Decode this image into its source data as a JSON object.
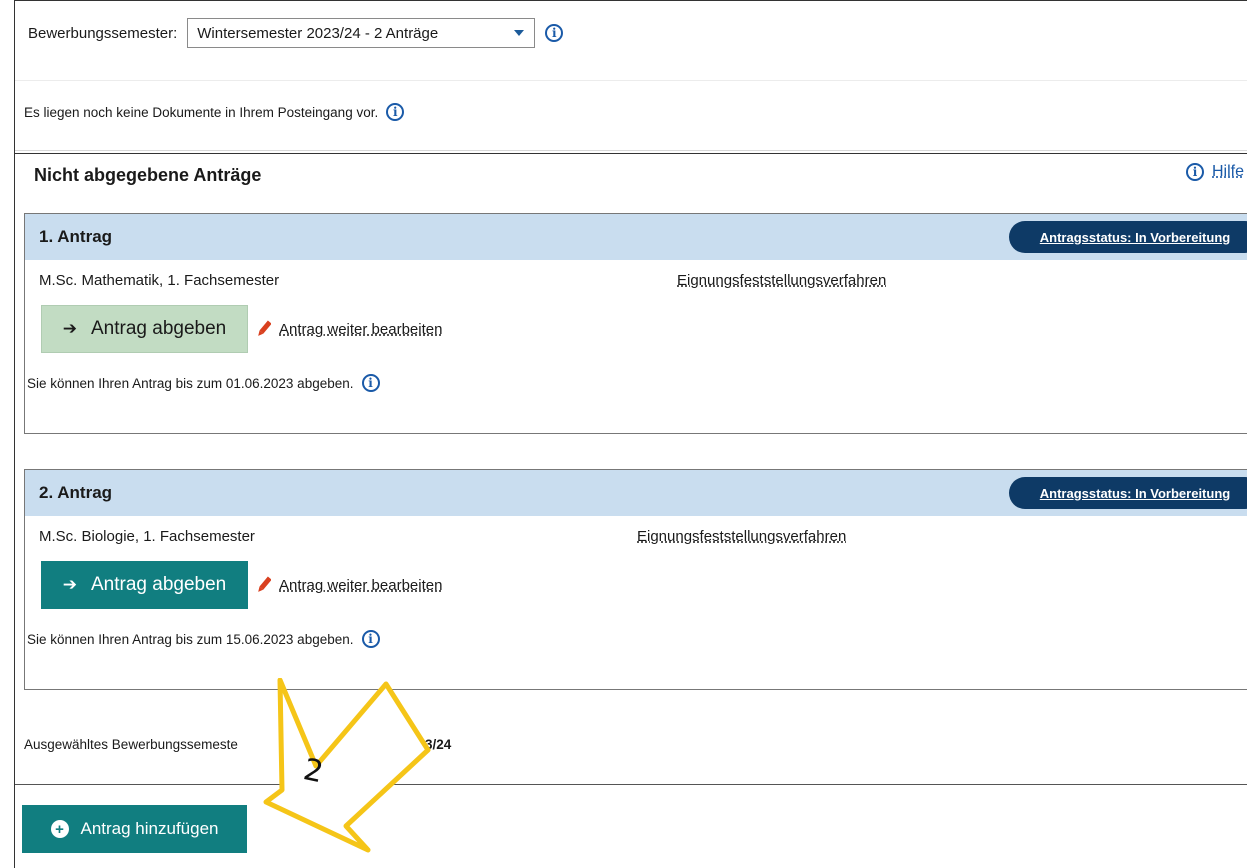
{
  "semester": {
    "label": "Bewerbungssemester:",
    "selected": "Wintersemester 2023/24 - 2 Anträge"
  },
  "inbox": {
    "message": "Es liegen noch keine Dokumente in Ihrem Posteingang vor."
  },
  "section": {
    "title": "Nicht abgegebene Anträge",
    "help_label": "Hilfe"
  },
  "applications": [
    {
      "title": "1. Antrag",
      "status": "Antragsstatus: In Vorbereitung",
      "course": "M.Sc. Mathematik, 1. Fachsemester",
      "procedure": "Eignungsfeststellungsverfahren",
      "submit_label": "Antrag abgeben",
      "submit_enabled": false,
      "edit_label": "Antrag weiter bearbeiten",
      "deadline": "Sie können Ihren Antrag bis zum 01.06.2023 abgeben."
    },
    {
      "title": "2. Antrag",
      "status": "Antragsstatus: In Vorbereitung",
      "course": "M.Sc. Biologie, 1. Fachsemester",
      "procedure": "Eignungsfeststellungsverfahren",
      "submit_label": "Antrag abgeben",
      "submit_enabled": true,
      "edit_label": "Antrag weiter bearbeiten",
      "deadline": "Sie können Ihren Antrag bis zum 15.06.2023 abgeben."
    }
  ],
  "footer": {
    "selected_semester_text": "Ausgewähltes Bewerbungssemeste",
    "selected_semester_tail": "023/24",
    "add_label": "Antrag hinzufügen"
  },
  "annotation": {
    "number": "2",
    "color": "#f5c518"
  },
  "colors": {
    "teal": "#117e80",
    "navy": "#0e3a66",
    "header_blue": "#c9ddef",
    "disabled_green": "#c2dcc3"
  },
  "icons": [
    "info-icon",
    "chevron-down-icon",
    "arrow-right-icon",
    "pencil-icon",
    "plus-circle-icon"
  ]
}
